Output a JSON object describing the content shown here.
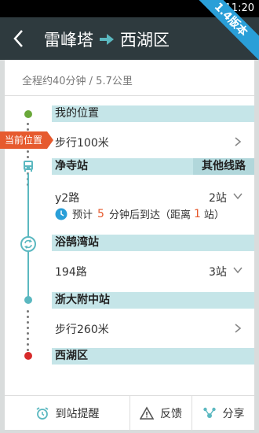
{
  "status": {
    "time": "11:20"
  },
  "ribbon": {
    "text": "1.4版本"
  },
  "header": {
    "from": "雷峰塔",
    "to": "西湖区"
  },
  "summary": "全程约40分钟 / 5.7公里",
  "current_tag": "当前位置",
  "steps": {
    "my_location": "我的位置",
    "walk1": "步行100米",
    "station1": "净寺站",
    "other_lines": "其他线路",
    "bus1": {
      "line": "y2路",
      "stops": "2站"
    },
    "eta": {
      "prefix": "预计",
      "minutes": "5",
      "mid": "分钟后到达（距离",
      "distance": "1",
      "suffix": "站）"
    },
    "transfer_station": "浴鹄湾站",
    "bus2": {
      "line": "194路",
      "stops": "3站"
    },
    "station3": "浙大附中站",
    "walk2": "步行260米",
    "destination": "西湖区"
  },
  "bottom": {
    "remind": "到站提醒",
    "feedback": "反馈",
    "share": "分享"
  },
  "colors": {
    "teal": "#5bb8c0",
    "green": "#6aa83a",
    "red": "#d72b2b",
    "orange": "#e65a2e"
  }
}
